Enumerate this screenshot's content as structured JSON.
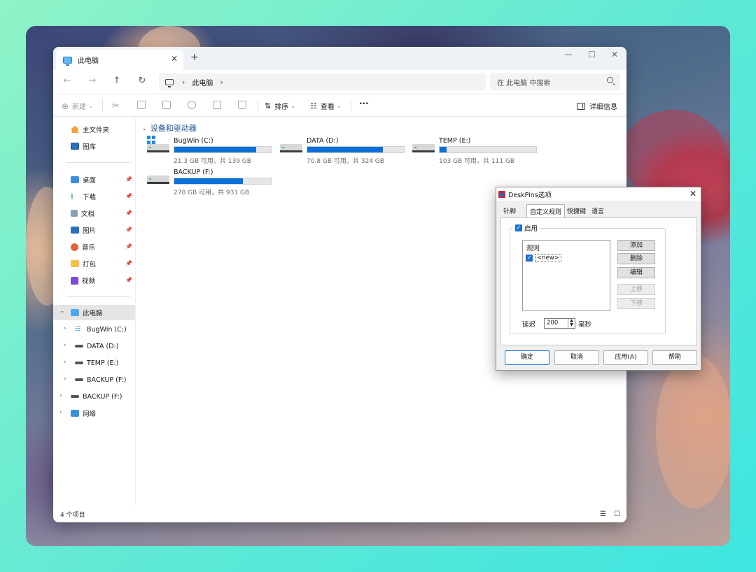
{
  "explorer": {
    "tab_title": "此电脑",
    "tab_close": "✕",
    "tab_add": "+",
    "window_controls": {
      "minimize": "—",
      "maximize": "☐",
      "close": "✕"
    },
    "nav": {
      "back": "←",
      "forward": "→",
      "up": "↑",
      "refresh": "↻"
    },
    "address": {
      "chevron": "›",
      "location": "此电脑",
      "trailing_chevron": "›"
    },
    "search_placeholder": "在 此电脑 中搜索",
    "toolbar": {
      "new_label": "新建",
      "new_chevron": "⌄",
      "sort_label": "排序",
      "sort_chevron": "⌄",
      "view_label": "查看",
      "view_chevron": "⌄",
      "more": "···",
      "details_label": "详细信息"
    },
    "sidebar": {
      "top_items": [
        {
          "label": "主文件夹",
          "icon": "home-icon"
        },
        {
          "label": "图库",
          "icon": "gallery-icon"
        }
      ],
      "quick_access": [
        {
          "label": "桌面",
          "icon": "desktop-icon"
        },
        {
          "label": "下载",
          "icon": "download-icon"
        },
        {
          "label": "文档",
          "icon": "document-icon"
        },
        {
          "label": "图片",
          "icon": "pictures-icon"
        },
        {
          "label": "音乐",
          "icon": "music-icon"
        },
        {
          "label": "打包",
          "icon": "folder-icon"
        },
        {
          "label": "视频",
          "icon": "video-icon"
        }
      ],
      "pin_glyph": "📌",
      "this_pc": "此电脑",
      "drives": [
        "BugWin (C:)",
        "DATA (D:)",
        "TEMP (E:)",
        "BACKUP (F:)"
      ],
      "backup_root": "BACKUP (F:)",
      "network": "网络",
      "chevron_right": "›",
      "chevron_down": "⌄"
    },
    "group_title": "设备和驱动器",
    "drives": [
      {
        "name": "BugWin (C:)",
        "info": "21.3 GB 可用，共 139 GB",
        "used_fraction": 0.847
      },
      {
        "name": "DATA (D:)",
        "info": "70.8 GB 可用，共 324 GB",
        "used_fraction": 0.781
      },
      {
        "name": "TEMP (E:)",
        "info": "103 GB 可用，共 111 GB",
        "used_fraction": 0.072
      },
      {
        "name": "BACKUP (F:)",
        "info": "270 GB 可用，共 931 GB",
        "used_fraction": 0.71
      }
    ],
    "status": "4 个项目",
    "view_icons": {
      "list": "☰",
      "tiles": "☐"
    }
  },
  "dialog": {
    "title": "DeskPins选项",
    "close": "✕",
    "tabs": [
      "针脚",
      "自定义规则",
      "快捷键",
      "语言"
    ],
    "enable_label": "启用",
    "check_glyph": "✓",
    "list_header": "规则",
    "rule_item": "<new>",
    "buttons": {
      "add": "添加",
      "delete": "删除",
      "edit": "编辑",
      "move_up": "上移",
      "move_down": "下移"
    },
    "delay_label": "延迟",
    "delay_value": "200",
    "spin_up": "▲",
    "spin_down": "▼",
    "delay_unit": "毫秒",
    "footer": {
      "ok": "确定",
      "cancel": "取消",
      "apply": "应用(A)",
      "help": "帮助"
    }
  },
  "colors": {
    "accent": "#0a6fd6",
    "group_title": "#1f4e8c",
    "drive_bar_fill": "#0a6fd6",
    "drive_bar_bg": "#e6e6e6",
    "checkbox": "#1f6fd0"
  }
}
